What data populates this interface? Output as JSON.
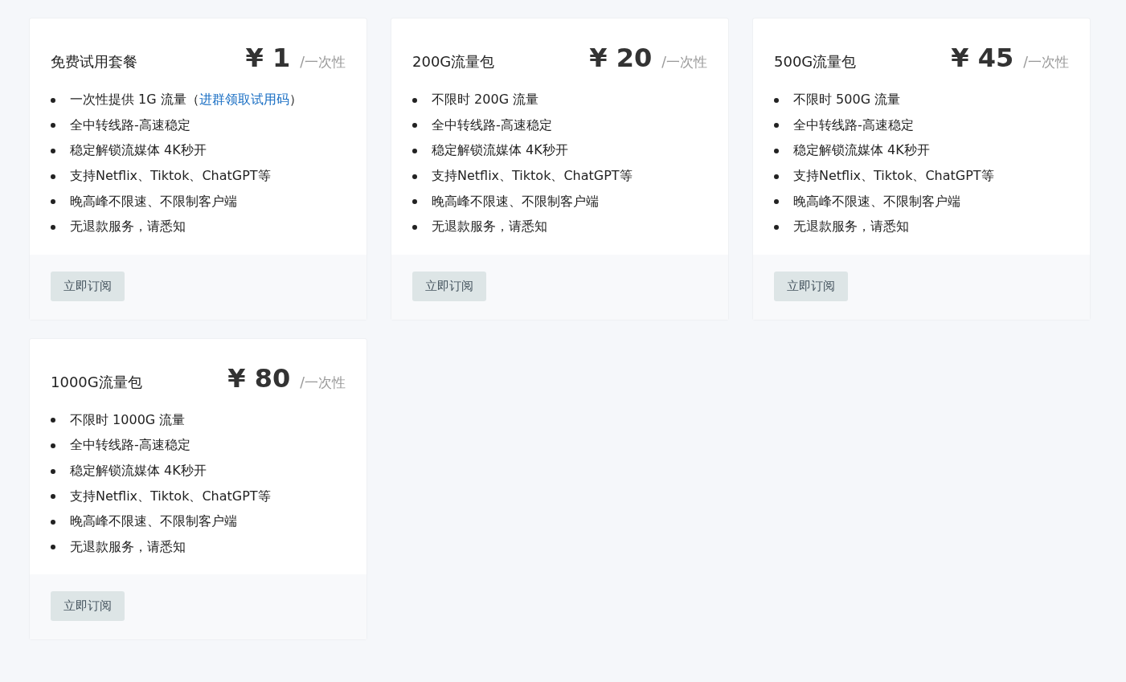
{
  "plans": [
    {
      "name": "免费试用套餐",
      "price": "¥ 1",
      "period": "/一次性",
      "features": [
        {
          "text": "一次性提供 1G 流量（",
          "link": "进群领取试用码",
          "after": "）"
        },
        {
          "text": "全中转线路-高速稳定"
        },
        {
          "text": "稳定解锁流媒体 4K秒开"
        },
        {
          "text": "支持Netflix、Tiktok、ChatGPT等"
        },
        {
          "text": "晚高峰不限速、不限制客户端"
        },
        {
          "text": "无退款服务，请悉知"
        }
      ],
      "button": "立即订阅"
    },
    {
      "name": "200G流量包",
      "price": "¥ 20",
      "period": "/一次性",
      "features": [
        {
          "text": "不限时 200G 流量"
        },
        {
          "text": "全中转线路-高速稳定"
        },
        {
          "text": "稳定解锁流媒体 4K秒开"
        },
        {
          "text": "支持Netflix、Tiktok、ChatGPT等"
        },
        {
          "text": "晚高峰不限速、不限制客户端"
        },
        {
          "text": "无退款服务，请悉知"
        }
      ],
      "button": "立即订阅"
    },
    {
      "name": "500G流量包",
      "price": "¥ 45",
      "period": "/一次性",
      "features": [
        {
          "text": "不限时 500G 流量"
        },
        {
          "text": "全中转线路-高速稳定"
        },
        {
          "text": "稳定解锁流媒体 4K秒开"
        },
        {
          "text": "支持Netflix、Tiktok、ChatGPT等"
        },
        {
          "text": "晚高峰不限速、不限制客户端"
        },
        {
          "text": "无退款服务，请悉知"
        }
      ],
      "button": "立即订阅"
    },
    {
      "name": "1000G流量包",
      "price": "¥ 80",
      "period": "/一次性",
      "features": [
        {
          "text": "不限时 1000G 流量"
        },
        {
          "text": "全中转线路-高速稳定"
        },
        {
          "text": "稳定解锁流媒体 4K秒开"
        },
        {
          "text": "支持Netflix、Tiktok、ChatGPT等"
        },
        {
          "text": "晚高峰不限速、不限制客户端"
        },
        {
          "text": "无退款服务，请悉知"
        }
      ],
      "button": "立即订阅"
    }
  ]
}
